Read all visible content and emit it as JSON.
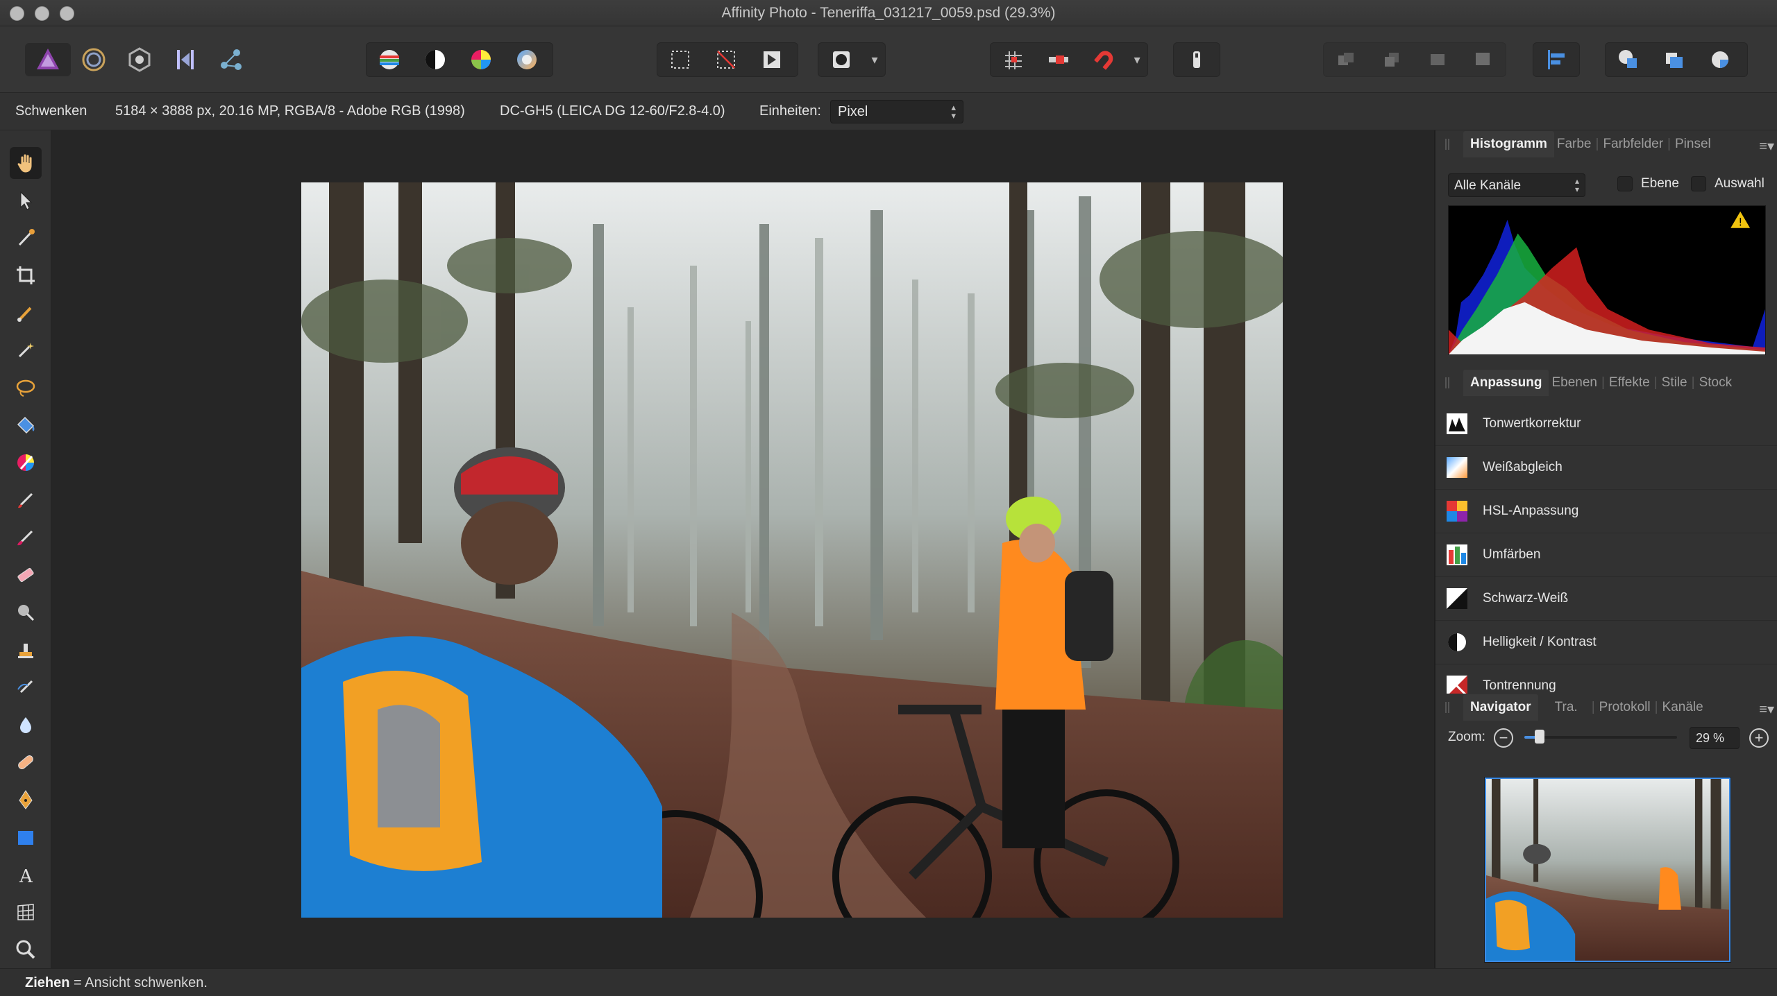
{
  "window": {
    "title": "Affinity Photo - Teneriffa_031217_0059.psd (29.3%)"
  },
  "toolbar": {
    "personas": [
      "photo-persona-icon",
      "liquify-persona-icon",
      "develop-persona-icon",
      "tone-mapping-persona-icon",
      "export-persona-icon"
    ],
    "adjust_buttons": [
      "auto-levels-icon",
      "auto-contrast-icon",
      "auto-colors-icon",
      "auto-white-balance-icon"
    ],
    "selection_buttons": [
      "select-all-icon",
      "deselect-icon",
      "invert-selection-icon"
    ],
    "quick_mask": "quick-mask-icon",
    "snapping": [
      "grid-icon",
      "snap-icon",
      "magnet-icon"
    ],
    "order": [
      "back-icon",
      "backward-icon",
      "forward-icon",
      "front-icon"
    ],
    "align": "align-icon",
    "boolean": [
      "add-icon",
      "subtract-icon",
      "intersect-icon"
    ]
  },
  "context": {
    "tool_name": "Schwenken",
    "image_info": "5184 × 3888 px, 20.16 MP, RGBA/8 - Adobe RGB (1998)",
    "camera_info": "DC-GH5 (LEICA DG 12-60/F2.8-4.0)",
    "units_label": "Einheiten:",
    "units_value": "Pixel"
  },
  "histogram_panel": {
    "tabs": [
      "Histogramm",
      "Farbe",
      "Farbfelder",
      "Pinsel"
    ],
    "channel": "Alle Kanäle",
    "layer_label": "Ebene",
    "selection_label": "Auswahl"
  },
  "adjustments_panel": {
    "tabs": [
      "Anpassung",
      "Ebenen",
      "Effekte",
      "Stile",
      "Stock"
    ],
    "items": [
      {
        "label": "Tonwertkorrektur",
        "icon": "levels-icon"
      },
      {
        "label": "Weißabgleich",
        "icon": "white-balance-icon"
      },
      {
        "label": "HSL-Anpassung",
        "icon": "hsl-icon"
      },
      {
        "label": "Umfärben",
        "icon": "recolor-icon"
      },
      {
        "label": "Schwarz-Weiß",
        "icon": "black-white-icon"
      },
      {
        "label": "Helligkeit / Kontrast",
        "icon": "brightness-contrast-icon"
      },
      {
        "label": "Tontrennung",
        "icon": "posterize-icon"
      }
    ]
  },
  "navigator_panel": {
    "tabs": [
      "Navigator",
      "Tra.",
      "Protokoll",
      "Kanäle"
    ],
    "zoom_label": "Zoom:",
    "zoom_value": "29 %",
    "zoom_fraction": 0.1
  },
  "status": {
    "key": "Ziehen",
    "text": " = Ansicht schwenken."
  },
  "colors": {
    "accent": "#4a90e2",
    "background": "#2c2c2c",
    "canvas": "#262626"
  }
}
